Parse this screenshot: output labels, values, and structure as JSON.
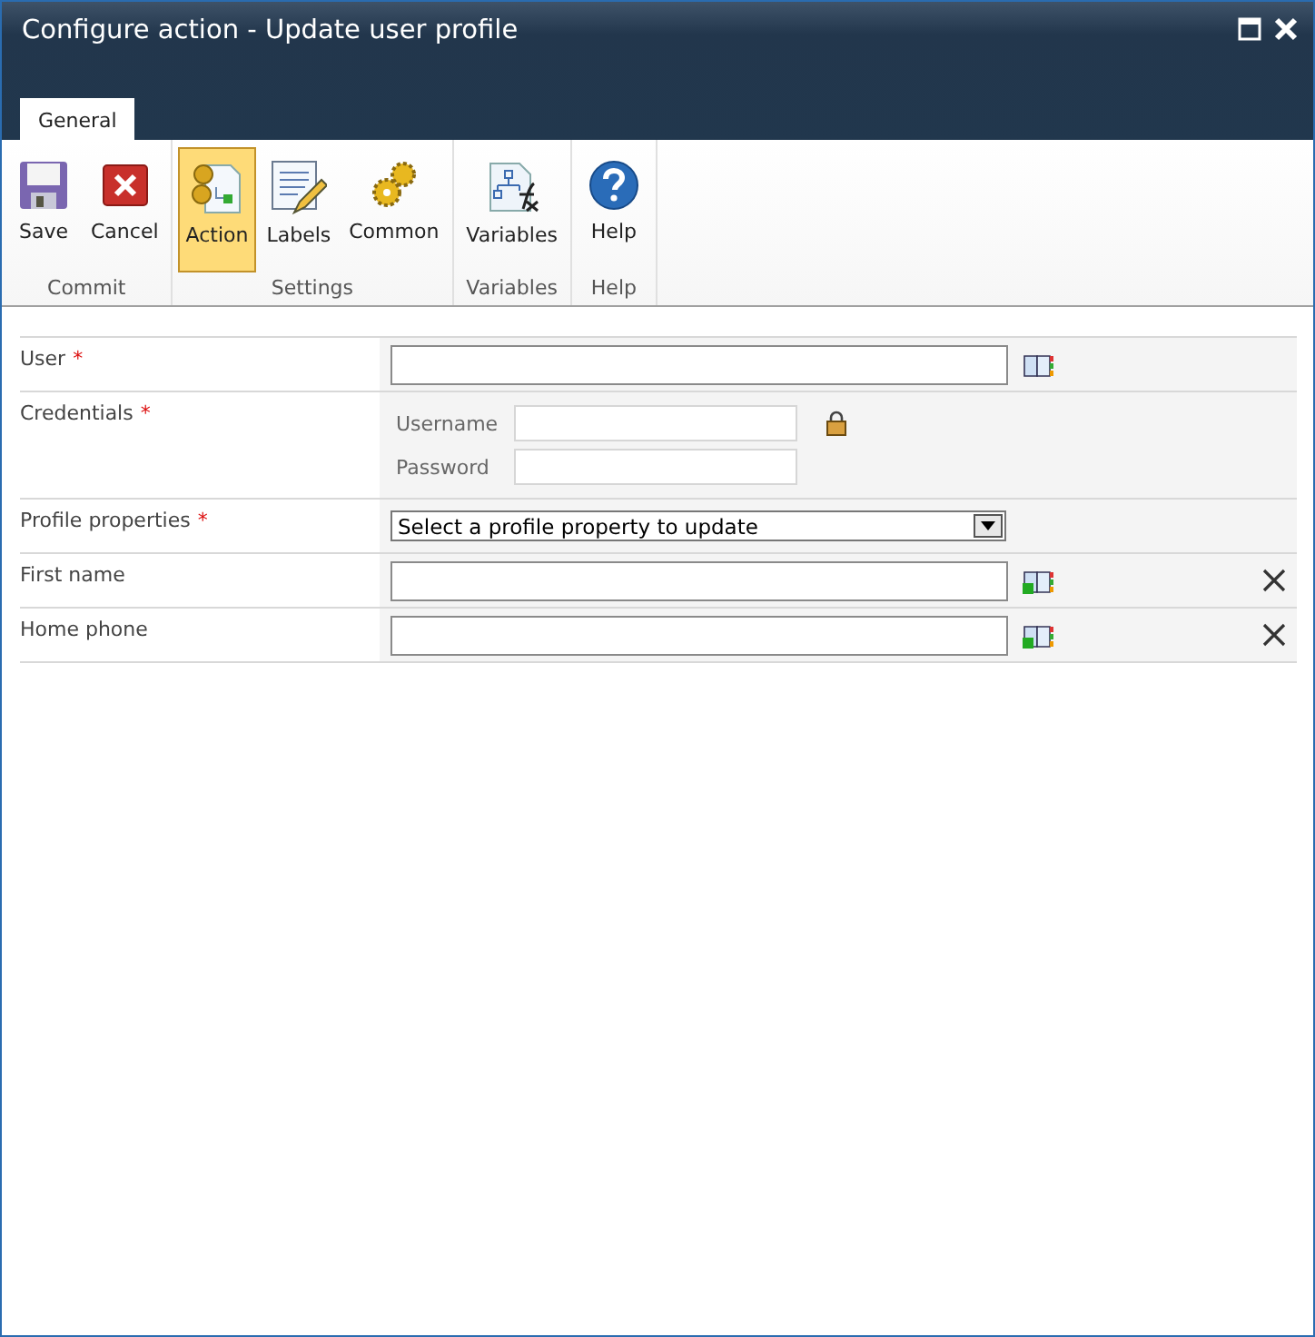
{
  "window": {
    "title": "Configure action - Update user profile"
  },
  "required_marker": "*",
  "tabs": [
    {
      "label": "General",
      "selected": true
    }
  ],
  "ribbon": [
    {
      "label": "Commit",
      "buttons": [
        {
          "label": "Save",
          "kind": "save",
          "selected": false
        },
        {
          "label": "Cancel",
          "kind": "cancel",
          "selected": false
        }
      ]
    },
    {
      "label": "Settings",
      "buttons": [
        {
          "label": "Action",
          "kind": "action",
          "selected": true
        },
        {
          "label": "Labels",
          "kind": "labels",
          "selected": false
        },
        {
          "label": "Common",
          "kind": "common",
          "selected": false
        }
      ]
    },
    {
      "label": "Variables",
      "buttons": [
        {
          "label": "Variables",
          "kind": "variables",
          "selected": false
        }
      ]
    },
    {
      "label": "Help",
      "buttons": [
        {
          "label": "Help",
          "kind": "help",
          "selected": false
        }
      ]
    }
  ],
  "form": [
    {
      "kind": "lookup",
      "label": "User",
      "required": true
    },
    {
      "kind": "credentials",
      "label": "Credentials",
      "required": true,
      "fields": [
        "Username",
        "Password"
      ]
    },
    {
      "kind": "select",
      "label": "Profile properties",
      "required": true,
      "value": "Select a profile property to update"
    },
    {
      "kind": "property",
      "label": "First name",
      "required": false
    },
    {
      "kind": "property",
      "label": "Home phone",
      "required": false
    }
  ]
}
